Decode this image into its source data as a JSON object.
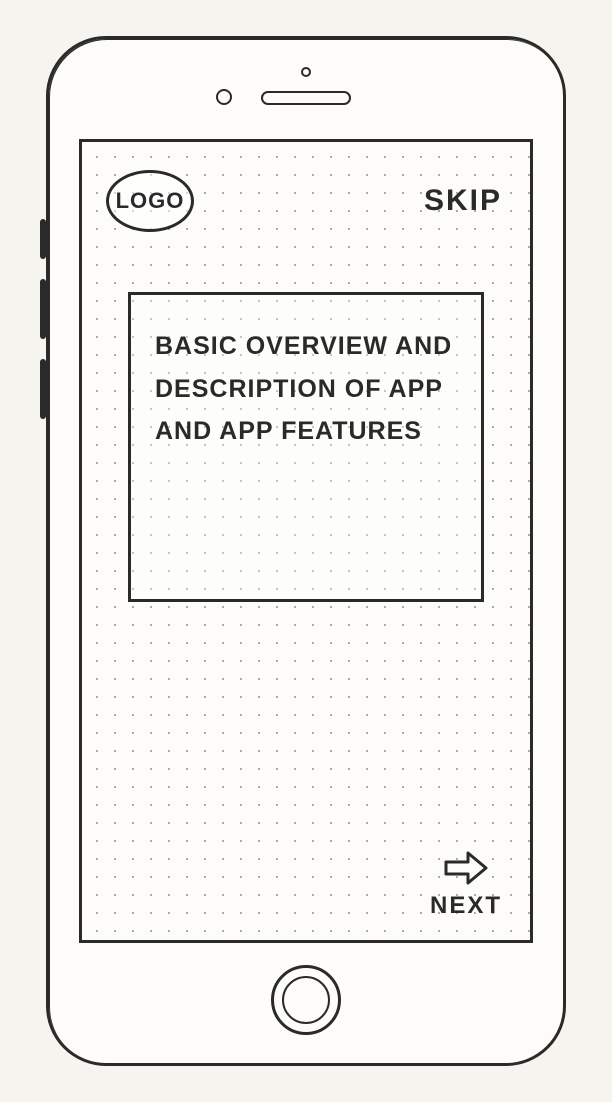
{
  "header": {
    "logo_label": "LOGO",
    "skip_label": "SKIP"
  },
  "content": {
    "body_text": "BASIC OVERVIEW AND DESCRIPTION OF APP AND APP FEATURES"
  },
  "footer": {
    "next_label": "NEXT"
  }
}
